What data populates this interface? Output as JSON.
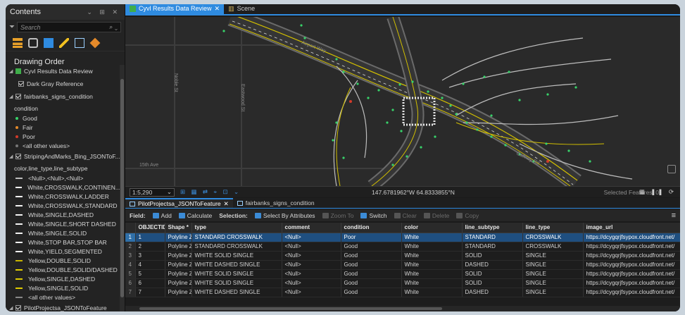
{
  "contents": {
    "title": "Contents",
    "search_placeholder": "Search",
    "drawing_order": "Drawing Order",
    "layers": [
      {
        "label": "Cyvl Results Data Review",
        "kind": "map"
      },
      {
        "label": "Dark Gray Reference",
        "kind": "layer"
      },
      {
        "label": "fairbanks_signs_condition",
        "kind": "layer"
      },
      {
        "label": "condition",
        "kind": "heading"
      },
      {
        "label": "Good",
        "kind": "dot",
        "color": "#38d26a"
      },
      {
        "label": "Fair",
        "kind": "dot",
        "color": "#e48a2a"
      },
      {
        "label": "Poor",
        "kind": "dot",
        "color": "#d23a2a"
      },
      {
        "label": "<all other values>",
        "kind": "dot",
        "color": "#777777"
      },
      {
        "label": "StripingAndMarks_Bing_JSONToF...",
        "kind": "layer"
      },
      {
        "label": "color,line_type,line_subtype",
        "kind": "heading"
      },
      {
        "label": "<Null>,<Null>,<Null>",
        "kind": "line",
        "color": "#bdbdbd"
      },
      {
        "label": "White,CROSSWALK,CONTINEN...",
        "kind": "line",
        "color": "#f2f2f2"
      },
      {
        "label": "White,CROSSWALK,LADDER",
        "kind": "line",
        "color": "#f2f2f2"
      },
      {
        "label": "White,CROSSWALK,STANDARD",
        "kind": "line",
        "color": "#f2f2f2"
      },
      {
        "label": "White,SINGLE,DASHED",
        "kind": "line",
        "color": "#f2f2f2"
      },
      {
        "label": "White,SINGLE,SHORT DASHED",
        "kind": "line",
        "color": "#f2f2f2"
      },
      {
        "label": "White,SINGLE,SOLID",
        "kind": "line",
        "color": "#f2f2f2"
      },
      {
        "label": "White,STOP BAR,STOP BAR",
        "kind": "line",
        "color": "#f2f2f2"
      },
      {
        "label": "White,YIELD,SEGMENTED",
        "kind": "line",
        "color": "#f2f2f2"
      },
      {
        "label": "Yellow,DOUBLE,SOLID",
        "kind": "line",
        "color": "#c8b400"
      },
      {
        "label": "Yellow,DOUBLE,SOLID/DASHED",
        "kind": "line",
        "color": "#e0cc00"
      },
      {
        "label": "Yellow,SINGLE,DASHED",
        "kind": "line",
        "color": "#e0cc00"
      },
      {
        "label": "Yellow,SINGLE,SOLID",
        "kind": "line",
        "color": "#e0cc00"
      },
      {
        "label": "<all other values>",
        "kind": "line",
        "color": "#888888"
      },
      {
        "label": "PilotProjectsa_JSONToFeature",
        "kind": "layer"
      }
    ]
  },
  "map": {
    "tabs": [
      {
        "label": "Cyvl Results Data Review",
        "active": true
      },
      {
        "label": "Scene",
        "active": false
      }
    ],
    "street_labels": {
      "noble": "Noble St",
      "eastwood": "Eastwood St",
      "ave": "15th Ave",
      "highway": "Airport Way",
      "ramp": "Gaffney Rd"
    },
    "scale": "1:5,290",
    "coordinates": "147.6781962°W 64.8333855°N",
    "selected_features": "Selected Features: 0"
  },
  "table": {
    "tabs": [
      {
        "label": "PilotProjectsa_JSONToFeature",
        "active": true
      },
      {
        "label": "fairbanks_signs_condition",
        "active": false
      }
    ],
    "toolbar": {
      "field_label": "Field:",
      "add": "Add",
      "calculate": "Calculate",
      "selection_label": "Selection:",
      "select_by_attributes": "Select By Attributes",
      "zoom_to": "Zoom To",
      "switch": "Switch",
      "clear": "Clear",
      "delete": "Delete",
      "copy": "Copy"
    },
    "columns": [
      "OBJECTID *",
      "Shape *",
      "type",
      "comment",
      "condition",
      "color",
      "line_subtype",
      "line_type",
      "image_url"
    ],
    "rows": [
      [
        "1",
        "Polyline Z",
        "STANDARD CROSSWALK",
        "<Null>",
        "Poor",
        "White",
        "STANDARD",
        "CROSSWALK",
        "https://dcygqrjfsypox.cloudfront.net/"
      ],
      [
        "2",
        "Polyline Z",
        "STANDARD CROSSWALK",
        "<Null>",
        "Good",
        "White",
        "STANDARD",
        "CROSSWALK",
        "https://dcygqrjfsypox.cloudfront.net/"
      ],
      [
        "3",
        "Polyline Z",
        "WHITE SOLID SINGLE",
        "<Null>",
        "Good",
        "White",
        "SOLID",
        "SINGLE",
        "https://dcygqrjfsypox.cloudfront.net/"
      ],
      [
        "4",
        "Polyline Z",
        "WHITE DASHED SINGLE",
        "<Null>",
        "Good",
        "White",
        "DASHED",
        "SINGLE",
        "https://dcygqrjfsypox.cloudfront.net/"
      ],
      [
        "5",
        "Polyline Z",
        "WHITE SOLID SINGLE",
        "<Null>",
        "Good",
        "White",
        "SOLID",
        "SINGLE",
        "https://dcygqrjfsypox.cloudfront.net/"
      ],
      [
        "6",
        "Polyline Z",
        "WHITE SOLID SINGLE",
        "<Null>",
        "Good",
        "White",
        "SOLID",
        "SINGLE",
        "https://dcygqrjfsypox.cloudfront.net/"
      ],
      [
        "7",
        "Polyline Z",
        "WHITE DASHED SINGLE",
        "<Null>",
        "Good",
        "White",
        "DASHED",
        "SINGLE",
        "https://dcygqrjfsypox.cloudfront.net/"
      ]
    ],
    "selected_row": 0
  },
  "colors": {
    "accent": "#2f8be0",
    "good": "#38d26a",
    "yellow_line": "#e0cc00"
  }
}
